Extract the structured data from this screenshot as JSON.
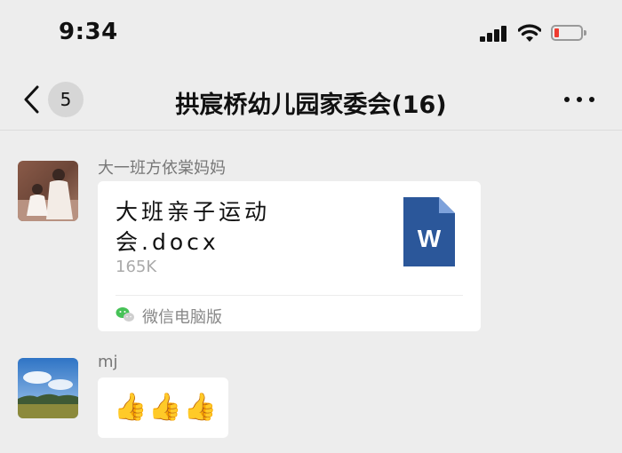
{
  "status_bar": {
    "time": "9:34"
  },
  "nav": {
    "back_count": "5",
    "title": "拱宸桥幼儿园家委会(16)"
  },
  "messages": [
    {
      "sender": "大一班方依棠妈妈",
      "type": "file",
      "file": {
        "name": "大班亲子运动会.docx",
        "size": "165K",
        "icon": "word-doc-icon",
        "icon_letter": "W",
        "source": "微信电脑版"
      }
    },
    {
      "sender": "mj",
      "type": "text",
      "text": "👍👍👍"
    }
  ],
  "colors": {
    "background": "#ededed",
    "bubble": "#ffffff",
    "word_blue": "#2b579a",
    "battery_low": "#ee3b30"
  }
}
